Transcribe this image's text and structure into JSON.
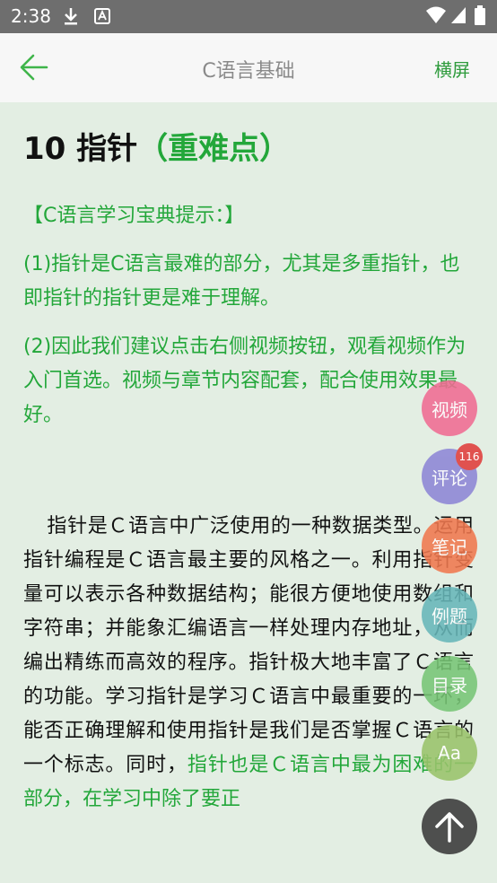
{
  "status_bar": {
    "time": "2:38"
  },
  "app_bar": {
    "title": "C语言基础",
    "landscape_label": "横屏"
  },
  "article": {
    "heading_num": "10 指针",
    "heading_accent": "（重难点）",
    "tip_title": "【C语言学习宝典提示：】",
    "tip_1": "(1)指针是C语言最难的部分，尤其是多重指针，也即指针的指针更是难于理解。",
    "tip_2": "(2)因此我们建议点击右侧视频按钮，观看视频作为入门首选。视频与章节内容配套，配合使用效果最好。",
    "body_normal": "指针是Ｃ语言中广泛使用的一种数据类型。运用指针编程是Ｃ语言最主要的风格之一。利用指针变量可以表示各种数据结构；能很方便地使用数组和字符串；并能象汇编语言一样处理内存地址，从而编出精练而高效的程序。指针极大地丰富了Ｃ语言的功能。学习指针是学习Ｃ语言中最重要的一环，能否正确理解和使用指针是我们是否掌握Ｃ语言的一个标志。同时，",
    "body_green": "指针也是Ｃ语言中最为困难的一部分，在学习中除了要正"
  },
  "floating_buttons": {
    "video": "视频",
    "comment": "评论",
    "comment_count": "116",
    "note": "笔记",
    "example": "例题",
    "toc": "目录",
    "font": "Aa"
  },
  "colors": {
    "accent_green": "#23a73a",
    "video": "#f06c93",
    "comment": "#8d86d6",
    "note": "#f0784f",
    "example": "#67b7b9",
    "toc": "#78c676",
    "font": "#9ac36b",
    "top": "#3a3a3a"
  }
}
